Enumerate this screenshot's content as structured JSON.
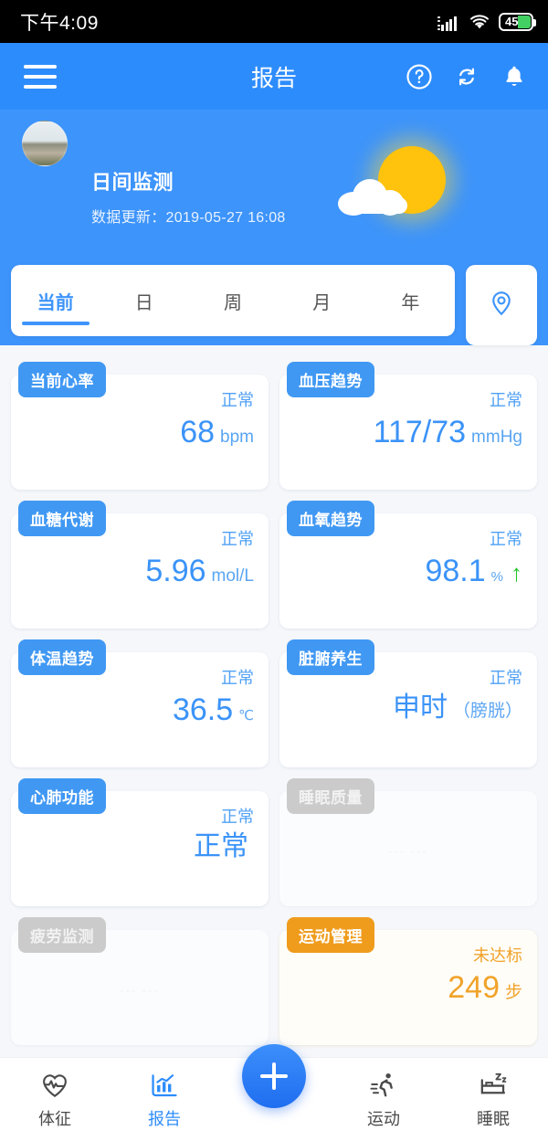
{
  "status_bar": {
    "time": "下午4:09",
    "battery_level": "45",
    "signal_icon": "signal-bars-icon",
    "wifi_icon": "wifi-icon",
    "battery_icon": "battery-icon"
  },
  "app_bar": {
    "menu_icon": "hamburger-menu-icon",
    "title": "报告",
    "help_icon": "help-circle-icon",
    "refresh_icon": "refresh-sync-icon",
    "bell_icon": "notification-bell-icon"
  },
  "hero": {
    "avatar": "user-avatar",
    "title": "日间监测",
    "subtitle": "数据更新：2019-05-27 16:08",
    "weather_icon": "sun-cloud-icon"
  },
  "tabs": {
    "items": [
      {
        "label": "当前",
        "active": true
      },
      {
        "label": "日",
        "active": false
      },
      {
        "label": "周",
        "active": false
      },
      {
        "label": "月",
        "active": false
      },
      {
        "label": "年",
        "active": false
      }
    ],
    "location_icon": "location-pin-icon"
  },
  "cards": [
    {
      "title": "当前心率",
      "status": "正常",
      "value": "68",
      "unit": "bpm",
      "theme": "blue",
      "trend": ""
    },
    {
      "title": "血压趋势",
      "status": "正常",
      "value": "117/73",
      "unit": "mmHg",
      "theme": "blue",
      "trend": ""
    },
    {
      "title": "血糖代谢",
      "status": "正常",
      "value": "5.96",
      "unit": "mol/L",
      "theme": "blue",
      "trend": ""
    },
    {
      "title": "血氧趋势",
      "status": "正常",
      "value": "98.1",
      "unit": "%",
      "theme": "blue",
      "trend": "↑"
    },
    {
      "title": "体温趋势",
      "status": "正常",
      "value": "36.5",
      "unit": "℃",
      "theme": "blue",
      "trend": ""
    },
    {
      "title": "脏腑养生",
      "status": "正常",
      "value": "申时",
      "unit": "（膀胱）",
      "theme": "blue",
      "trend": ""
    },
    {
      "title": "心肺功能",
      "status": "正常",
      "value": "正常",
      "unit": "",
      "theme": "blue",
      "trend": ""
    },
    {
      "title": "睡眠质量",
      "status": "",
      "value": "",
      "unit": "",
      "theme": "disabled",
      "placeholder": "--- ---",
      "trend": ""
    },
    {
      "title": "疲劳监测",
      "status": "",
      "value": "",
      "unit": "",
      "theme": "disabled",
      "placeholder": "--- ---",
      "trend": ""
    },
    {
      "title": "运动管理",
      "status": "未达标",
      "value": "249",
      "unit": "步",
      "theme": "orange",
      "trend": ""
    }
  ],
  "bottom_nav": {
    "items": [
      {
        "label": "体征",
        "icon": "heart-pulse-icon",
        "active": false
      },
      {
        "label": "报告",
        "icon": "bar-chart-icon",
        "active": true
      },
      {
        "label": "运动",
        "icon": "running-icon",
        "active": false
      },
      {
        "label": "睡眠",
        "icon": "sleep-bed-icon",
        "active": false
      }
    ],
    "fab_icon": "plus-icon"
  },
  "colors": {
    "brand_blue": "#2d8cfc",
    "hero_blue": "#3d94fb",
    "badge_blue": "#4098f3",
    "orange": "#ef9c1d",
    "gray_badge": "#cbcbcb",
    "green_arrow": "#25c52a",
    "sun_yellow": "#ffc20d",
    "battery_green": "#43d063"
  }
}
